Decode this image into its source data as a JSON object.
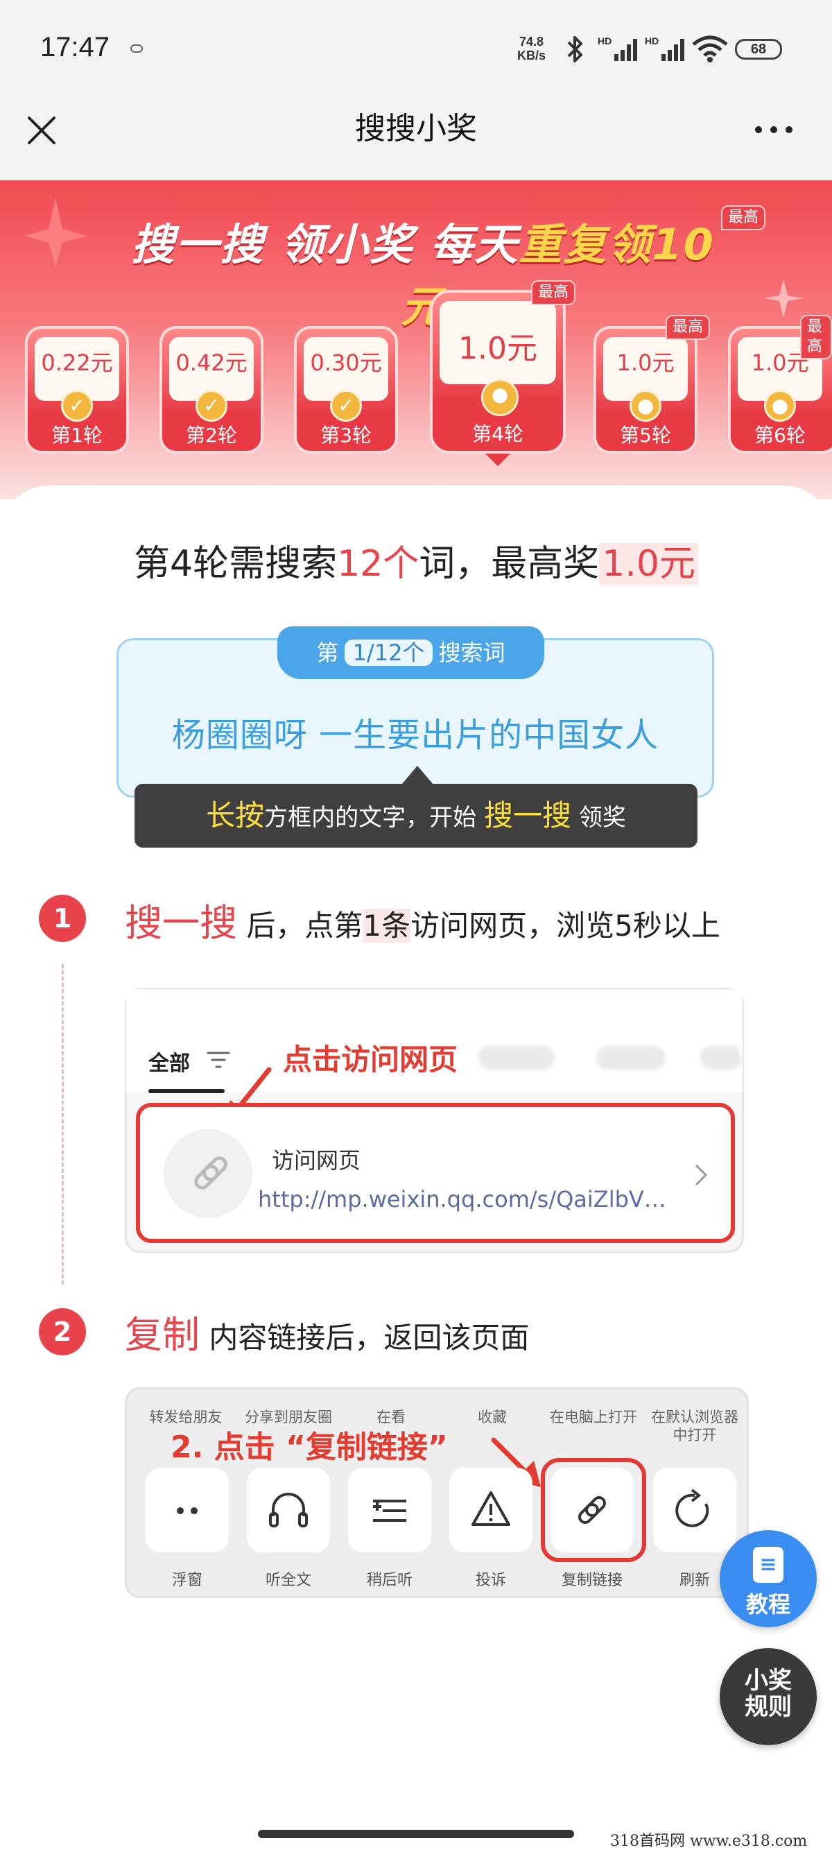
{
  "status_bar": {
    "time": "17:47",
    "net_speed_top": "74.8",
    "net_speed_unit": "KB/s",
    "hd1": "HD",
    "hd2": "HD",
    "battery": "68"
  },
  "nav": {
    "title": "搜搜小奖",
    "close_icon": "close-icon",
    "more_icon": "more-icon"
  },
  "hero": {
    "title_part1": "搜一搜 领小奖 每天",
    "title_part2": "重复领10元",
    "badge": "最高"
  },
  "rounds": [
    {
      "amount": "0.22元",
      "label": "第1轮",
      "done": true
    },
    {
      "amount": "0.42元",
      "label": "第2轮",
      "done": true
    },
    {
      "amount": "0.30元",
      "label": "第3轮",
      "done": true
    },
    {
      "amount": "1.0元",
      "label": "第4轮",
      "badge": "最高",
      "current": true
    },
    {
      "amount": "1.0元",
      "label": "第5轮",
      "badge": "最高"
    },
    {
      "amount": "1.0元",
      "label": "第6轮",
      "badge": "最高"
    }
  ],
  "round_info": {
    "prefix": "第4轮需搜索",
    "count": "12个",
    "middle": "词，最高奖",
    "max": "1.0元"
  },
  "keyword": {
    "tab_prefix": "第",
    "tab_progress": "1/12个",
    "tab_suffix": "搜索词",
    "text": "杨圈圈呀 一生要出片的中国女人"
  },
  "tip": {
    "a": "长按",
    "b": "方框内的文字，开始",
    "c": "搜一搜",
    "d": "领奖"
  },
  "step1": {
    "num": "1",
    "big": "搜一搜",
    "t1": " 后，点第",
    "t2": "1条",
    "t3": "访问网页，浏览5秒以上"
  },
  "shot1": {
    "tab_all": "全部",
    "hint": "点击访问网页",
    "result_title": "访问网页",
    "result_url": "http://mp.weixin.qq.com/s/QaiZlbVf…"
  },
  "step2": {
    "num": "2",
    "big": "复制",
    "text": " 内容链接后，返回该页面"
  },
  "shot2": {
    "top_labels": [
      "转发给朋友",
      "分享到朋友圈",
      "在看",
      "收藏",
      "在电脑上打开",
      "在默认浏览器中打开"
    ],
    "hint": "2. 点击 “复制链接”",
    "buttons": [
      {
        "label": "浮窗",
        "icon": "dots-icon"
      },
      {
        "label": "听全文",
        "icon": "headphones-icon"
      },
      {
        "label": "稍后听",
        "icon": "playlist-icon"
      },
      {
        "label": "投诉",
        "icon": "warning-icon"
      },
      {
        "label": "复制链接",
        "icon": "link-icon"
      },
      {
        "label": "刷新",
        "icon": "refresh-icon"
      }
    ]
  },
  "fabs": {
    "tutorial": "教程",
    "rules_line1": "小奖",
    "rules_line2": "规则"
  },
  "watermark": "318首码网  www.e318.com",
  "colors": {
    "accent_red": "#e8434b",
    "keyword_blue": "#3a9ee0",
    "tab_blue": "#4aa6e8",
    "gold": "#f3b73d"
  }
}
